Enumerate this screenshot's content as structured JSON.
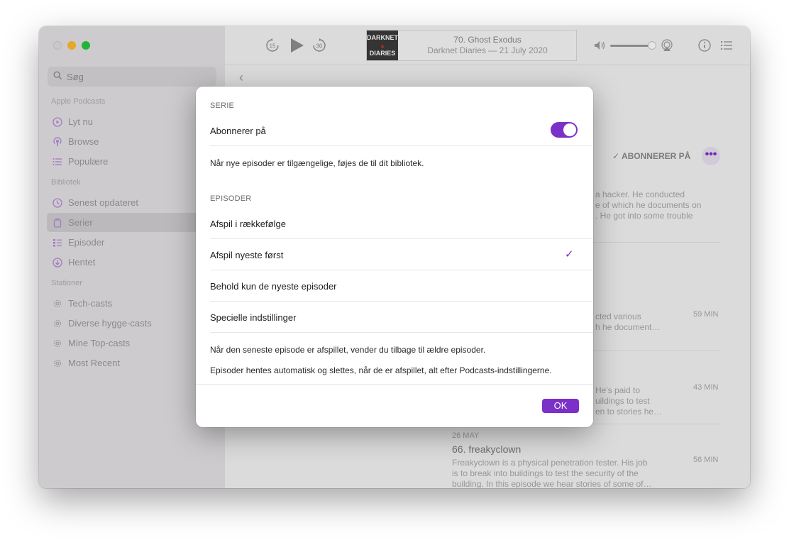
{
  "sidebar": {
    "search_placeholder": "Søg",
    "sections": {
      "apple": "Apple Podcasts",
      "library": "Bibliotek",
      "stations": "Stationer"
    },
    "apple_items": [
      "Lyt nu",
      "Browse",
      "Populære"
    ],
    "library_items": [
      "Senest opdateret",
      "Serier",
      "Episoder",
      "Hentet"
    ],
    "station_items": [
      "Tech-casts",
      "Diverse hygge-casts",
      "Mine Top-casts",
      "Most Recent"
    ],
    "selected": "Serier"
  },
  "toolbar": {
    "skip_back": "15",
    "skip_forward": "30",
    "artwork_lines": [
      "DARKNET",
      "DIARIES"
    ],
    "title": "70. Ghost Exodus",
    "subtitle": "Darknet Diaries — 21 July 2020"
  },
  "main": {
    "subscribe_label": "✓ ABONNERER PÅ",
    "desc_lines": [
      "a hacker. He conducted",
      "e of which he documents on",
      ". He got into some trouble"
    ],
    "episodes": [
      {
        "lines": [
          "cted various",
          "h he document…"
        ],
        "duration": "59 MIN"
      },
      {
        "lines": [
          "He's paid to",
          "uildings to test",
          "en to stories he…"
        ],
        "duration": "43 MIN"
      },
      {
        "date": "26 MAY",
        "title": "66. freakyclown",
        "lines": [
          "Freakyclown is a physical penetration tester. His job",
          "is to break into buildings to test the security of the",
          "building. In this episode we hear stories of some of…"
        ],
        "duration": "56 MIN"
      }
    ]
  },
  "dialog": {
    "series_heading": "SERIE",
    "subscribe_label": "Abonnerer på",
    "subscribe_on": true,
    "subscribe_note": "Når nye episoder er tilgængelige, føjes de til dit bibliotek.",
    "episodes_heading": "EPISODER",
    "options": [
      "Afspil i rækkefølge",
      "Afspil nyeste først",
      "Behold kun de nyeste episoder",
      "Specielle indstillinger"
    ],
    "selected_option": "Afspil nyeste først",
    "note1": "Når den seneste episode er afspillet, vender du tilbage til ældre episoder.",
    "note2": "Episoder hentes automatisk og slettes, når de er afspillet, alt efter Podcasts-indstillingerne.",
    "ok_label": "OK"
  },
  "colors": {
    "accent": "#7b30c8"
  }
}
